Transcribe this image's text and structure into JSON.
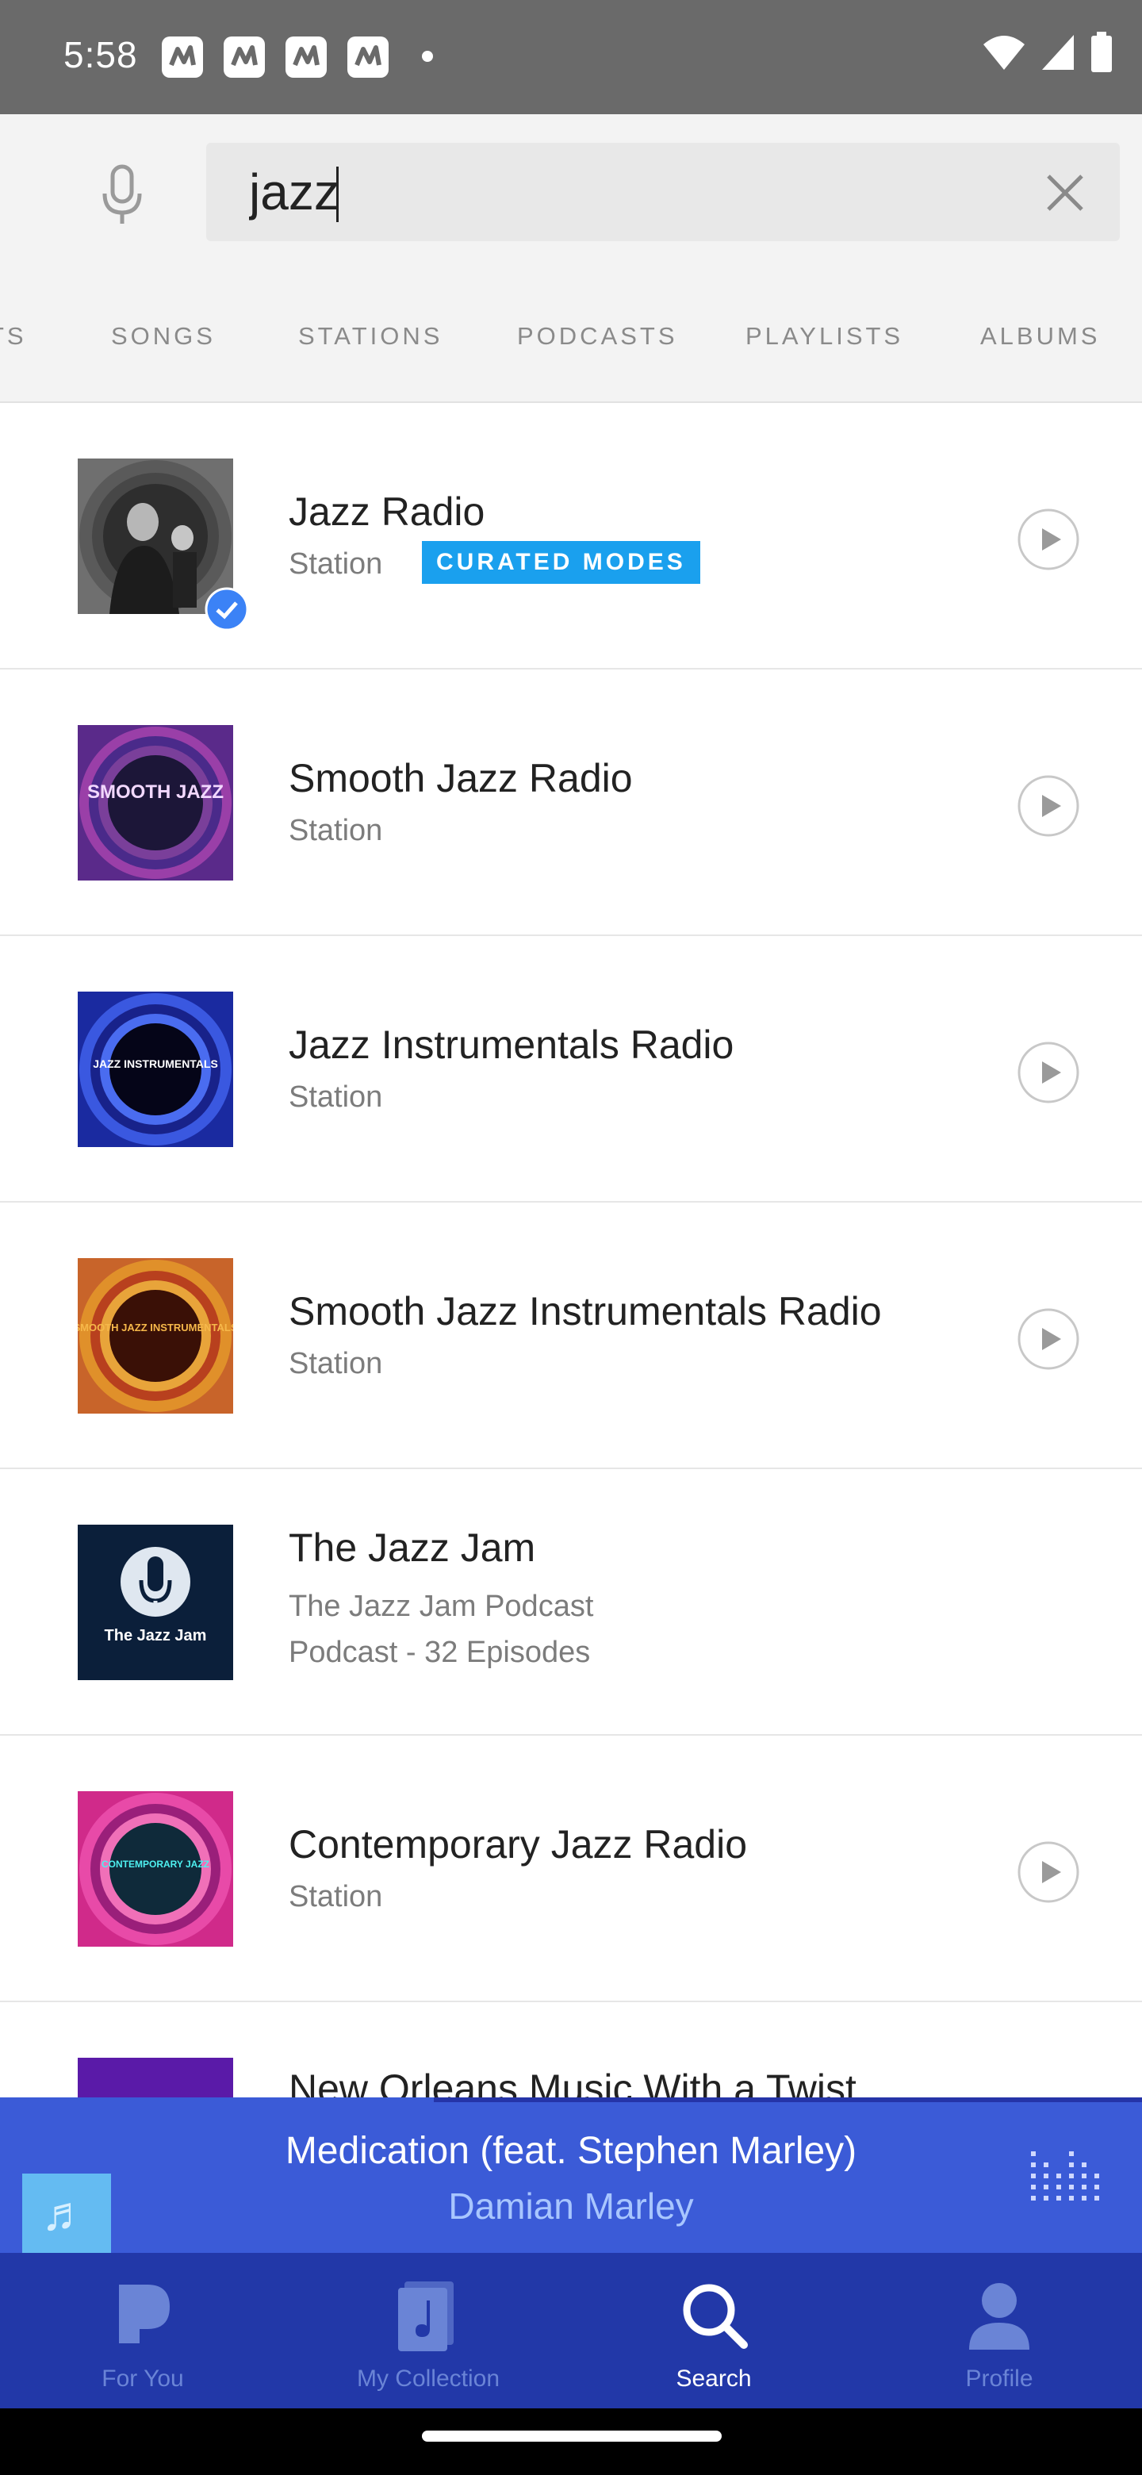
{
  "status_bar": {
    "time": "5:58",
    "icons": [
      "pandora-notification-icon",
      "pandora-notification-icon",
      "pandora-notification-icon",
      "pandora-notification-icon",
      "more-notifications-dot",
      "wifi-icon",
      "signal-icon",
      "battery-icon"
    ]
  },
  "search": {
    "value": "jazz",
    "mic_icon": "microphone-icon",
    "clear_icon": "close-icon"
  },
  "tabs": [
    {
      "label": "TS"
    },
    {
      "label": "SONGS"
    },
    {
      "label": "STATIONS"
    },
    {
      "label": "PODCASTS"
    },
    {
      "label": "PLAYLISTS"
    },
    {
      "label": "ALBUMS"
    }
  ],
  "results": [
    {
      "title": "Jazz Radio",
      "subtitle": "Station",
      "badge": "CURATED MODES",
      "art_text": ""
    },
    {
      "title": "Smooth Jazz Radio",
      "subtitle": "Station",
      "art_text": "SMOOTH JAZZ"
    },
    {
      "title": "Jazz Instrumentals Radio",
      "subtitle": "Station",
      "art_text": "JAZZ INSTRUMENTALS"
    },
    {
      "title": "Smooth Jazz Instrumentals Radio",
      "subtitle": "Station",
      "art_text": "SMOOTH JAZZ INSTRUMENTALS"
    },
    {
      "title": "The Jazz Jam",
      "subtitle": "The Jazz Jam Podcast",
      "subtitle2": "Podcast - 32 Episodes",
      "art_text": "The Jazz Jam"
    },
    {
      "title": "Contemporary Jazz Radio",
      "subtitle": "Station",
      "art_text": "CONTEMPORARY JAZZ"
    },
    {
      "title": "New Orleans Music With a Twist",
      "subtitle": ""
    }
  ],
  "now_playing": {
    "title": "Medication (feat. Stephen Marley)",
    "artist": "Damian Marley",
    "progress": 0.38
  },
  "bottom_nav": [
    {
      "label": "For You",
      "icon": "pandora-p-icon"
    },
    {
      "label": "My Collection",
      "icon": "collection-icon"
    },
    {
      "label": "Search",
      "icon": "search-icon",
      "active": true
    },
    {
      "label": "Profile",
      "icon": "profile-icon"
    }
  ],
  "colors": {
    "accent": "#1aa0ee",
    "player_bg": "#3b5bd7",
    "nav_bg": "#2238a8"
  }
}
